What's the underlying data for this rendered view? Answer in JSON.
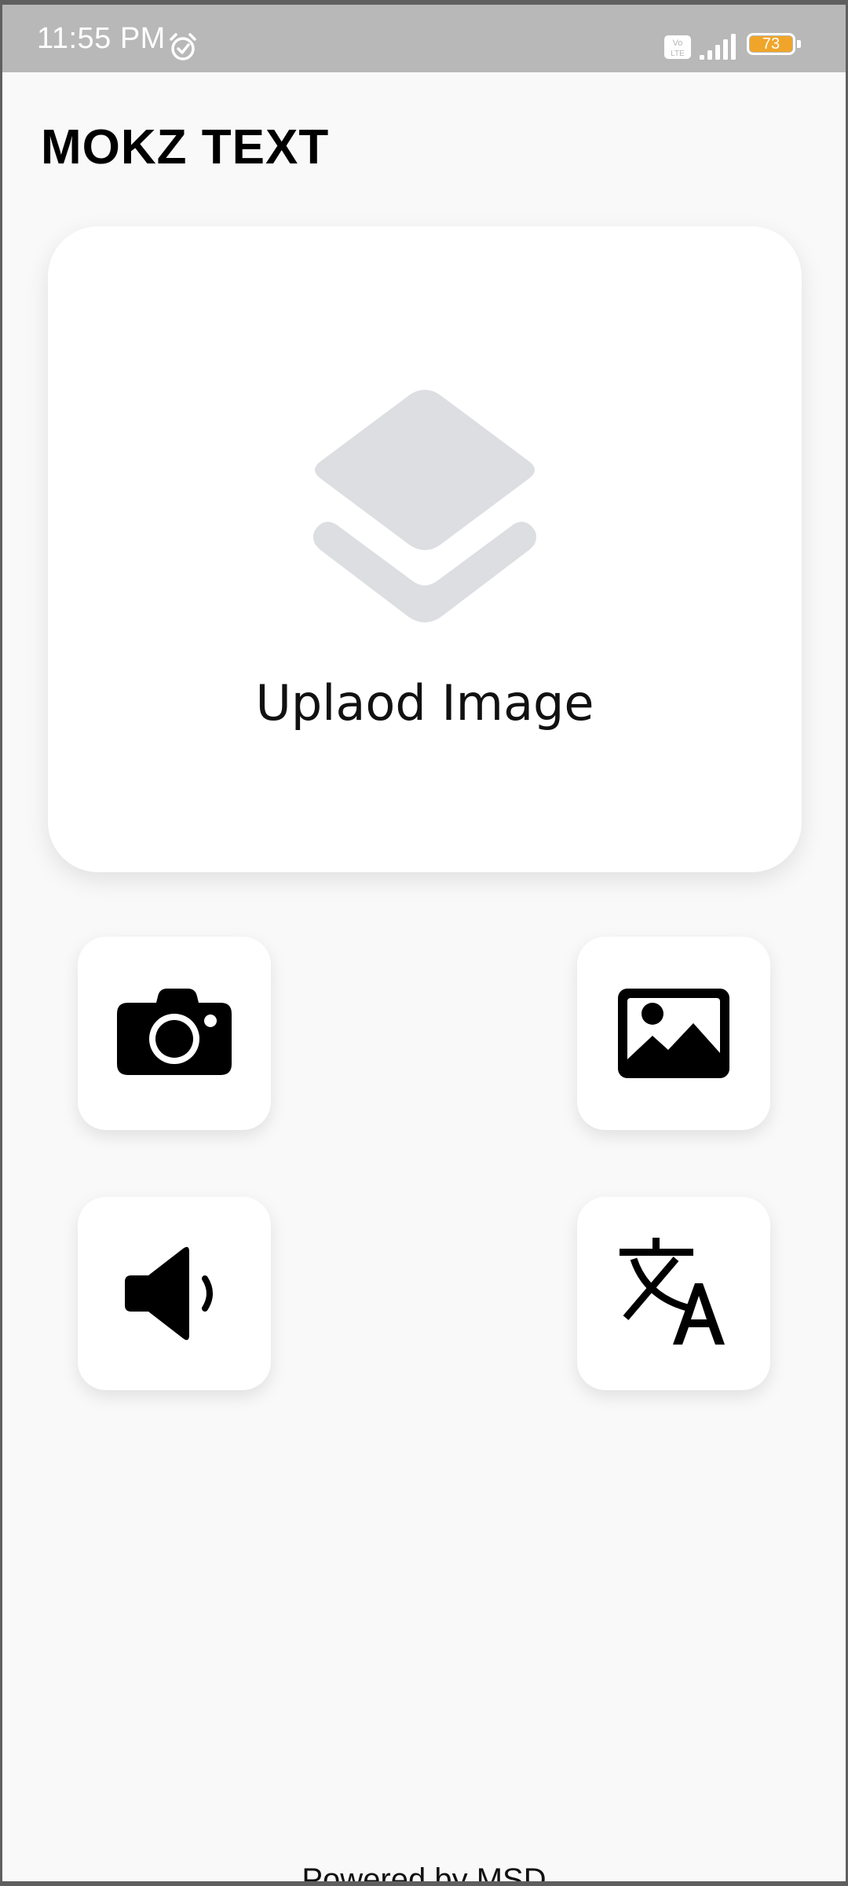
{
  "status_bar": {
    "time": "11:55 PM",
    "battery_level": "73",
    "battery_fill_color": "#f0a52a",
    "alarm_icon": "alarm-clock-icon",
    "volte_icon": "volte-icon",
    "signal_icon": "cell-signal-icon"
  },
  "app": {
    "title": "MOKZ TEXT"
  },
  "upload_card": {
    "label": "Uplaod Image",
    "icon": "layers-icon",
    "icon_color": "#dcdee1"
  },
  "actions": {
    "camera": {
      "icon": "camera-icon"
    },
    "gallery": {
      "icon": "image-icon"
    },
    "speaker": {
      "icon": "speaker-icon"
    },
    "translate": {
      "icon": "translate-icon"
    }
  },
  "footer": {
    "text": "Powered by MSD"
  }
}
